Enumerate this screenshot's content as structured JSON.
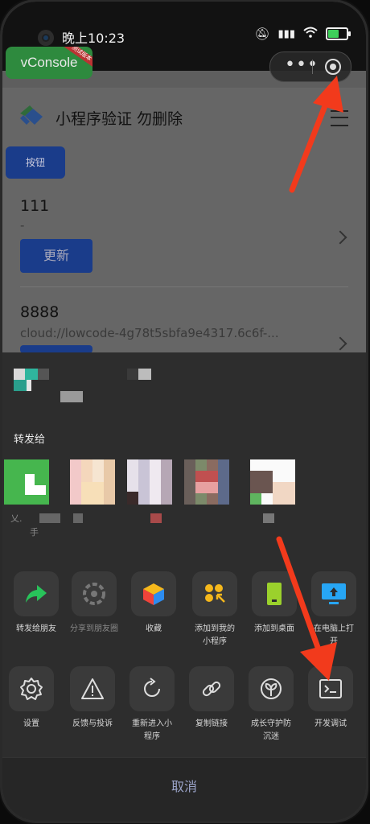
{
  "status_bar": {
    "time": "晚上10:23",
    "icons": [
      "mute-icon",
      "signal-icon",
      "wifi-icon",
      "battery-icon"
    ]
  },
  "vconsole": {
    "label": "vConsole",
    "ribbon": "测试版本"
  },
  "capsule": {
    "more": "•••",
    "icons": [
      "more-icon",
      "close-target-icon"
    ]
  },
  "page": {
    "title": "小程序验证 勿删除",
    "button_label": "按钮",
    "items": [
      {
        "title": "111",
        "sub": "-",
        "button": "更新"
      },
      {
        "title": "8888",
        "sub": "cloud://lowcode-4g78t5sbfa9e4317.6c6f-..."
      }
    ]
  },
  "sheet": {
    "forward_label": "转发给",
    "contacts": [
      {
        "name": "乂.",
        "sub": "手"
      },
      {
        "name": "",
        "sub": ""
      },
      {
        "name": "",
        "sub": ""
      },
      {
        "name": "",
        "sub": ""
      },
      {
        "name": "",
        "sub": ""
      }
    ],
    "row1": [
      {
        "label": "转发给朋友",
        "icon": "share-arrow-icon",
        "dim": false
      },
      {
        "label": "分享到朋友圈",
        "icon": "moments-icon",
        "dim": true
      },
      {
        "label": "收藏",
        "icon": "favorite-cube-icon",
        "dim": false
      },
      {
        "label": "添加到我的小程序",
        "icon": "add-mini-program-icon",
        "dim": false
      },
      {
        "label": "添加到桌面",
        "icon": "add-desktop-icon",
        "dim": false
      },
      {
        "label": "在电脑上打开",
        "icon": "open-on-pc-icon",
        "dim": false
      }
    ],
    "row2": [
      {
        "label": "设置",
        "icon": "gear-icon"
      },
      {
        "label": "反馈与投诉",
        "icon": "warning-icon"
      },
      {
        "label": "重新进入小程序",
        "icon": "reload-icon"
      },
      {
        "label": "复制链接",
        "icon": "link-icon"
      },
      {
        "label": "成长守护防沉迷",
        "icon": "sprout-icon"
      },
      {
        "label": "开发调试",
        "icon": "terminal-icon"
      }
    ],
    "cancel": "取消"
  },
  "colors": {
    "accent_blue": "#1a3c8a",
    "sheet_bg": "#2d2d2d",
    "annotation_red": "#f23a1c"
  }
}
